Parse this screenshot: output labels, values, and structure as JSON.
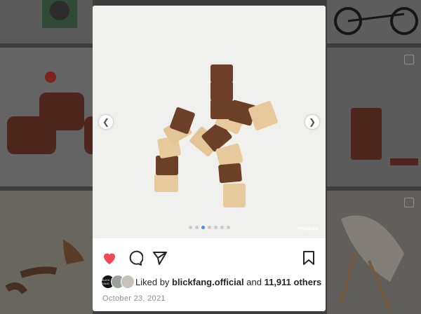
{
  "post": {
    "watermark": "megosu",
    "carousel": {
      "count": 7,
      "active_index": 2
    },
    "liked_prefix": "Liked by",
    "liked_user": "blickfang.official",
    "liked_and": "and",
    "liked_count": "11,911 others",
    "date": "October 23, 2021",
    "avatar_text": "BLICK FANG"
  },
  "icons": {
    "like": "heart-filled-icon",
    "comment": "comment-bubble-icon",
    "share": "paper-plane-icon",
    "save": "bookmark-icon",
    "prev": "chevron-left-icon",
    "next": "chevron-right-icon"
  },
  "colors": {
    "like_red": "#ed4956",
    "dot_active": "#4a90e2",
    "text": "#262626",
    "muted": "#8e8e8e"
  }
}
